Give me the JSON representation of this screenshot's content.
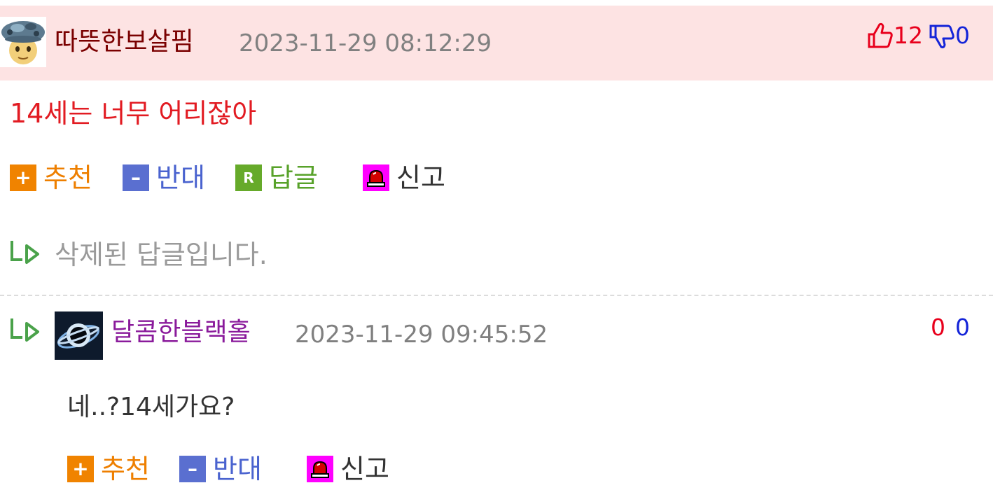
{
  "comment": {
    "nickname": "따뜻한보살핌",
    "timestamp": "2023-11-29 08:12:29",
    "upvotes": "12",
    "downvotes": "0",
    "body": "14세는 너무 어리잖아",
    "actions": {
      "recommend": "추천",
      "oppose": "반대",
      "reply": "답글",
      "report": "신고"
    },
    "colors": {
      "header_bg": "#fde3e3",
      "nickname": "#7a0000",
      "body": "#e21b22"
    }
  },
  "deleted_reply": {
    "text": "삭제된 답글입니다."
  },
  "reply": {
    "nickname": "달콤한블랙홀",
    "timestamp": "2023-11-29 09:45:52",
    "upvotes": "0",
    "downvotes": "0",
    "body": "네..?14세가요?",
    "actions": {
      "recommend": "추천",
      "oppose": "반대",
      "report": "신고"
    },
    "colors": {
      "nickname": "#8a1a9b"
    }
  },
  "icons": {
    "recommend": "plus-icon",
    "oppose": "minus-icon",
    "reply": "reply-r-icon",
    "report": "siren-icon",
    "thumbs_up": "thumbs-up-icon",
    "thumbs_down": "thumbs-down-icon",
    "reply_arrow": "reply-arrow-icon"
  }
}
